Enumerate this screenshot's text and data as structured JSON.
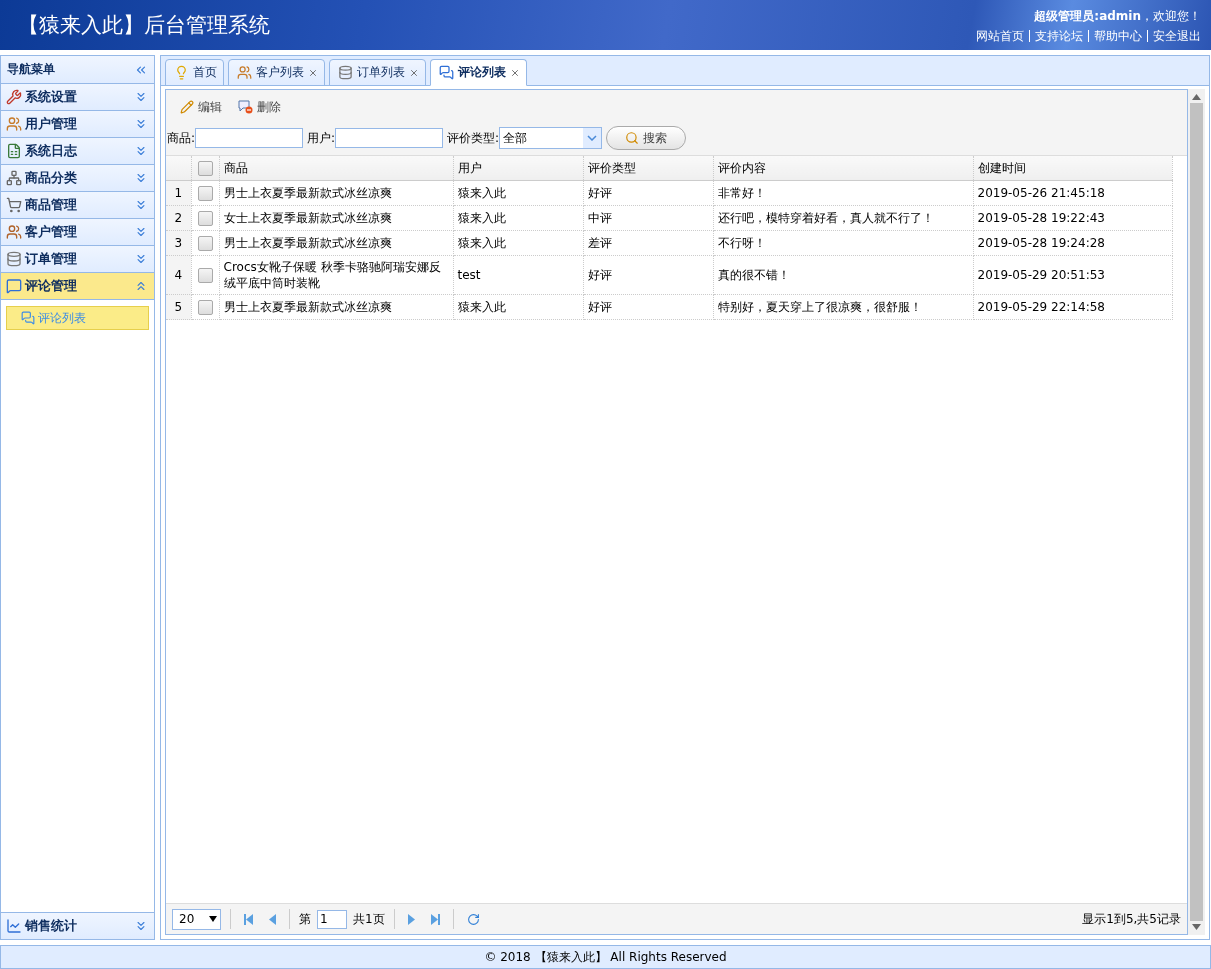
{
  "header": {
    "title": "【猿来入此】后台管理系统",
    "greeting": "**超级管理员:admin**，欢迎您！",
    "links": [
      "网站首页",
      "支持论坛",
      "帮助中心",
      "安全退出"
    ]
  },
  "sidebar": {
    "title": "导航菜单",
    "items": [
      {
        "label": "系统设置",
        "expanded": false
      },
      {
        "label": "用户管理",
        "expanded": false
      },
      {
        "label": "系统日志",
        "expanded": false
      },
      {
        "label": "商品分类",
        "expanded": false
      },
      {
        "label": "商品管理",
        "expanded": false
      },
      {
        "label": "客户管理",
        "expanded": false
      },
      {
        "label": "订单管理",
        "expanded": false
      },
      {
        "label": "评论管理",
        "expanded": true,
        "children": [
          {
            "label": "评论列表",
            "selected": true
          }
        ]
      }
    ],
    "bottom_item": {
      "label": "销售统计",
      "expanded": false
    }
  },
  "tabs": [
    {
      "label": "首页",
      "closable": false,
      "selected": false
    },
    {
      "label": "客户列表",
      "closable": true,
      "selected": false
    },
    {
      "label": "订单列表",
      "closable": true,
      "selected": false
    },
    {
      "label": "评论列表",
      "closable": true,
      "selected": true
    }
  ],
  "toolbar": [
    "编辑",
    "删除"
  ],
  "search": {
    "fields": [
      {
        "label": "商品:",
        "kind": "text"
      },
      {
        "label": "用户:",
        "kind": "text"
      },
      {
        "label": "评价类型:",
        "kind": "select",
        "value": "全部"
      }
    ],
    "button": "搜索"
  },
  "table": {
    "header_checked": false,
    "columns": [
      "商品",
      "用户",
      "评价类型",
      "评价内容",
      "创建时间"
    ],
    "rows": [
      {
        "number": "1",
        "checked": false,
        "cells": [
          "男士上衣夏季最新款式冰丝凉爽",
          "猿来入此",
          "好评",
          "非常好！",
          "2019-05-26 21:45:18"
        ]
      },
      {
        "number": "2",
        "checked": false,
        "cells": [
          "女士上衣夏季最新款式冰丝凉爽",
          "猿来入此",
          "中评",
          "还行吧，模特穿着好看，真人就不行了！",
          "2019-05-28 19:22:43"
        ]
      },
      {
        "number": "3",
        "checked": false,
        "cells": [
          "男士上衣夏季最新款式冰丝凉爽",
          "猿来入此",
          "差评",
          "不行呀！",
          "2019-05-28 19:24:28"
        ]
      },
      {
        "number": "4",
        "checked": false,
        "cells": [
          "Crocs女靴子保暖 秋季卡骆驰阿瑞安娜反绒平底中筒时装靴",
          "test",
          "好评",
          "真的很不错！",
          "2019-05-29 20:51:53"
        ]
      },
      {
        "number": "5",
        "checked": false,
        "cells": [
          "男士上衣夏季最新款式冰丝凉爽",
          "猿来入此",
          "好评",
          "特别好，夏天穿上了很凉爽，很舒服！",
          "2019-05-29 22:14:58"
        ]
      }
    ]
  },
  "pager": {
    "page_size": "20",
    "before": "第",
    "page": "1",
    "after": "共1页",
    "summary": "显示1到5,共5记录"
  },
  "footer": "© 2018 【猿来入此】 All Rights Reserved"
}
